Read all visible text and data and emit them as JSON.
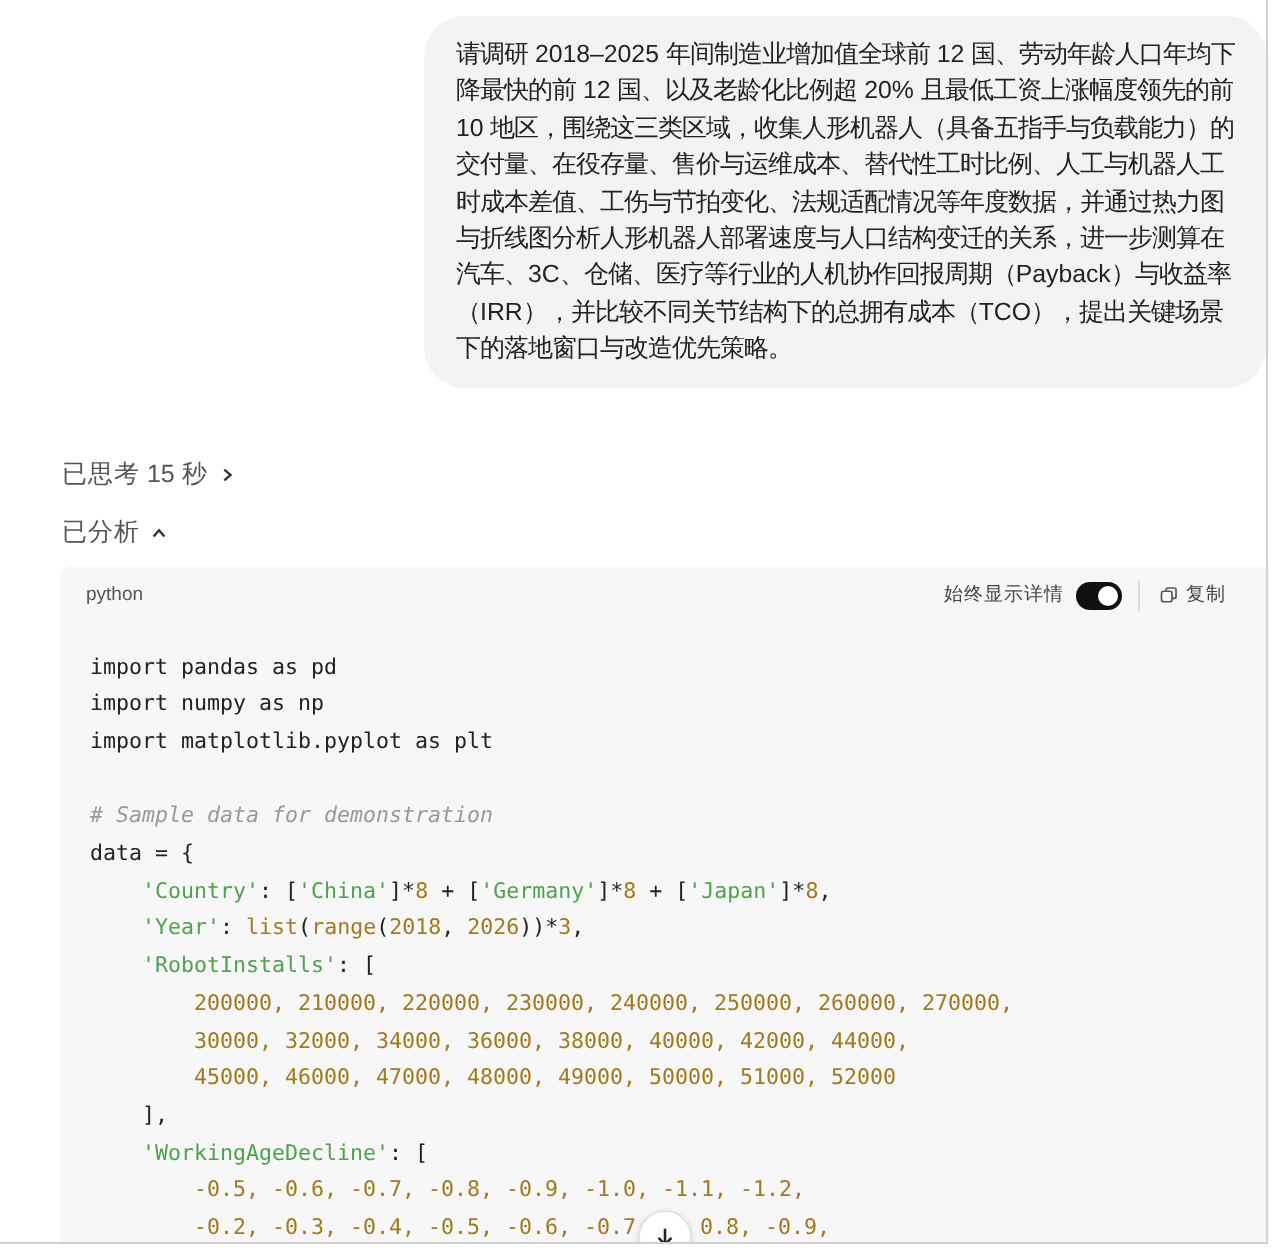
{
  "user_message": {
    "text": "请调研 2018–2025 年间制造业增加值全球前 12 国、劳动年龄人口年均下降最快的前 12 国、以及老龄化比例超 20% 且最低工资上涨幅度领先的前 10 地区，围绕这三类区域，收集人形机器人（具备五指手与负载能力）的交付量、在役存量、售价与运维成本、替代性工时比例、人工与机器人工时成本差值、工伤与节拍变化、法规适配情况等年度数据，并通过热力图与折线图分析人形机器人部署速度与人口结构变迁的关系，进一步测算在汽车、3C、仓储、医疗等行业的人机协作回报周期（Payback）与收益率（IRR），并比较不同关节结构下的总拥有成本（TCO），提出关键场景下的落地窗口与改造优先策略。"
  },
  "thinking": {
    "label": "已思考 15 秒",
    "expanded": false
  },
  "analysis": {
    "label": "已分析",
    "expanded": true
  },
  "code_block": {
    "language": "python",
    "toggle": {
      "label": "始终显示详情",
      "on": true
    },
    "copy_label": "复制",
    "lines": [
      {
        "tokens": [
          {
            "kind": "plain",
            "text": "import pandas as pd"
          }
        ]
      },
      {
        "tokens": [
          {
            "kind": "plain",
            "text": "import numpy as np"
          }
        ]
      },
      {
        "tokens": [
          {
            "kind": "plain",
            "text": "import matplotlib.pyplot as plt"
          }
        ]
      },
      {
        "space_before": true,
        "tokens": [
          {
            "kind": "comment",
            "text": "# Sample data for demonstration"
          }
        ]
      },
      {
        "tokens": [
          {
            "kind": "plain",
            "text": "data = {"
          }
        ]
      },
      {
        "tokens": [
          {
            "kind": "str",
            "text": "    'Country'"
          },
          {
            "kind": "plain",
            "text": ": ["
          },
          {
            "kind": "str",
            "text": "'China'"
          },
          {
            "kind": "plain",
            "text": "]*"
          },
          {
            "kind": "num",
            "text": "8"
          },
          {
            "kind": "plain",
            "text": " + ["
          },
          {
            "kind": "str",
            "text": "'Germany'"
          },
          {
            "kind": "plain",
            "text": "]*"
          },
          {
            "kind": "num",
            "text": "8"
          },
          {
            "kind": "plain",
            "text": " + ["
          },
          {
            "kind": "str",
            "text": "'Japan'"
          },
          {
            "kind": "plain",
            "text": "]*"
          },
          {
            "kind": "num",
            "text": "8"
          },
          {
            "kind": "plain",
            "text": ","
          }
        ]
      },
      {
        "tokens": [
          {
            "kind": "str",
            "text": "    'Year'"
          },
          {
            "kind": "plain",
            "text": ": "
          },
          {
            "kind": "num",
            "text": "list"
          },
          {
            "kind": "plain",
            "text": "("
          },
          {
            "kind": "num",
            "text": "range"
          },
          {
            "kind": "plain",
            "text": "("
          },
          {
            "kind": "num",
            "text": "2018"
          },
          {
            "kind": "plain",
            "text": ", "
          },
          {
            "kind": "num",
            "text": "2026"
          },
          {
            "kind": "plain",
            "text": "))*"
          },
          {
            "kind": "num",
            "text": "3"
          },
          {
            "kind": "plain",
            "text": ","
          }
        ]
      },
      {
        "tokens": [
          {
            "kind": "str",
            "text": "    'RobotInstalls'"
          },
          {
            "kind": "plain",
            "text": ": ["
          }
        ]
      },
      {
        "tokens": [
          {
            "kind": "num",
            "text": "        200000, 210000, 220000, 230000, 240000, 250000, 260000, 270000,"
          }
        ]
      },
      {
        "tokens": [
          {
            "kind": "num",
            "text": "        30000, 32000, 34000, 36000, 38000, 40000, 42000, 44000,"
          }
        ]
      },
      {
        "tokens": [
          {
            "kind": "num",
            "text": "        45000, 46000, 47000, 48000, 49000, 50000, 51000, 52000"
          }
        ]
      },
      {
        "tokens": [
          {
            "kind": "plain",
            "text": "    ],"
          }
        ]
      },
      {
        "tokens": [
          {
            "kind": "str",
            "text": "    'WorkingAgeDecline'"
          },
          {
            "kind": "plain",
            "text": ": ["
          }
        ]
      },
      {
        "tokens": [
          {
            "kind": "num",
            "text": "        -0.5, -0.6, -0.7, -0.8, -0.9, -1.0, -1.1, -1.2,"
          }
        ]
      },
      {
        "segments": [
          [
            {
              "kind": "num",
              "text": "        -0.2, -0.3, -0.4, -0.5, -0.6, -0.7"
            }
          ],
          [
            {
              "kind": "num",
              "text": "0.8, -0.9,"
            }
          ]
        ]
      }
    ]
  }
}
